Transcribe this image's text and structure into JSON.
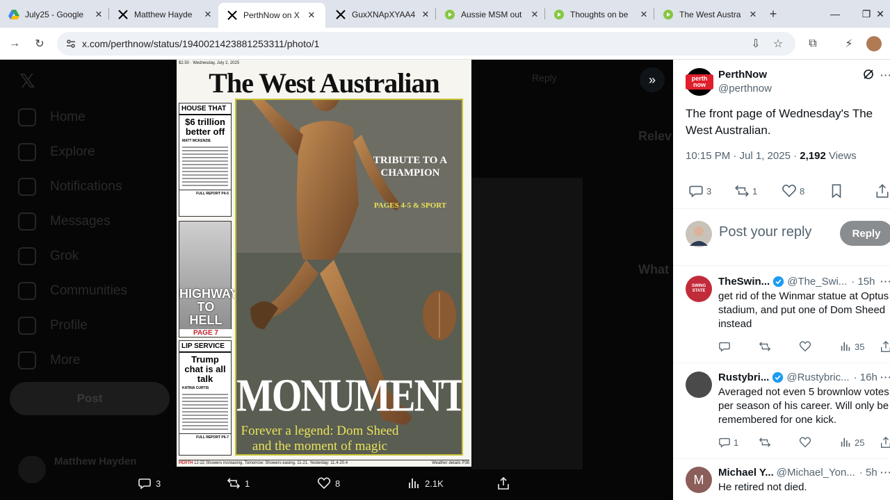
{
  "browser": {
    "tabs": [
      {
        "title": "July25 - Google",
        "favicon": "google-drive-icon"
      },
      {
        "title": "Matthew Hayde",
        "favicon": "x-icon"
      },
      {
        "title": "PerthNow on X",
        "favicon": "x-icon",
        "active": true
      },
      {
        "title": "GuxXNApXYAA4",
        "favicon": "x-icon"
      },
      {
        "title": "Aussie MSM out",
        "favicon": "rumble-icon"
      },
      {
        "title": "Thoughts on be",
        "favicon": "rumble-icon"
      },
      {
        "title": "The West Austra",
        "favicon": "rumble-icon"
      }
    ],
    "url": "x.com/perthnow/status/1940021423881253311/photo/1"
  },
  "xbg": {
    "nav": [
      "Home",
      "Explore",
      "Notifications",
      "Messages",
      "Grok",
      "Communities",
      "Profile",
      "More"
    ],
    "post_label": "Post",
    "profile_name": "Matthew Hayden",
    "reply_label": "Reply",
    "relevant_label": "Relev",
    "whats_label": "What"
  },
  "newspaper": {
    "topline": "$2.50 · Wednesday, July 2, 2025",
    "masthead": "The West Australian",
    "story1": {
      "kicker": "HOUSE THAT",
      "headline": "$6 trillion better off",
      "byline": "MATT MCKENZIE",
      "foot": "FULL REPORT P4-5"
    },
    "story2": {
      "headline": "HIGHWAY TO HELL",
      "page": "PAGE 7"
    },
    "story3": {
      "kicker": "LIP SERVICE",
      "headline": "Trump chat is all talk",
      "byline": "KATINA CURTIS",
      "foot": "FULL REPORT P6-7"
    },
    "tribute": "TRIBUTE TO A CHAMPION",
    "tribute_pages": "PAGES 4-5 & SPORT",
    "main_headline": "MONUMENTAL",
    "sub_headline": "Forever a legend: Dom Sheed and the moment of magic",
    "weather_city": "PERTH",
    "weather": "12-22 Showers increasing. Tomorrow: Showers easing. 11-21. Yesterday: 11.4-20.4",
    "weather_details": "Weather details P38"
  },
  "media_bar": {
    "replies": "3",
    "reposts": "1",
    "likes": "8",
    "views": "2.1K"
  },
  "post": {
    "author": "PerthNow",
    "handle": "@perthnow",
    "avatar_text": "perth now",
    "text": "The front page of Wednesday's The West Australian.",
    "time": "10:15 PM · Jul 1, 2025 · ",
    "views_count": "2,192",
    "views_label": " Views",
    "replies": "3",
    "reposts": "1",
    "likes": "8",
    "reply_placeholder": "Post your reply",
    "reply_button": "Reply"
  },
  "replies": [
    {
      "name": "TheSwin...",
      "handle": "@The_Swi...",
      "time": "· 15h",
      "text": "get rid of the Winmar statue at Optus stadium, and put one of Dom Sheed instead",
      "replies": "",
      "reposts": "",
      "likes": "",
      "views": "35",
      "avatar_color": "#c22b3a",
      "avatar_text": "SWING STATE"
    },
    {
      "name": "Rustybri...",
      "handle": "@Rustybric...",
      "time": "· 16h",
      "text": "Averaged not even 5 brownlow votes per season of his career. Will only be remembered for one kick.",
      "replies": "1",
      "reposts": "",
      "likes": "",
      "views": "25",
      "avatar_color": "#4a4a4a",
      "avatar_text": ""
    },
    {
      "name": "Michael Y...",
      "handle": "@Michael_Yon...",
      "time": "· 5h",
      "text": "He retired not died.",
      "avatar_color": "#8b5e5a",
      "avatar_text": "M"
    }
  ]
}
